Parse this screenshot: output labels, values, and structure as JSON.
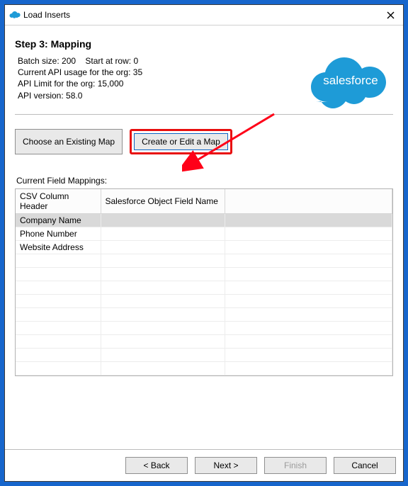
{
  "titlebar": {
    "title": "Load Inserts"
  },
  "step": {
    "heading": "Step 3: Mapping"
  },
  "info": {
    "batch_size_label": "Batch size:",
    "batch_size_value": "200",
    "start_row_label": "Start at row:",
    "start_row_value": "0",
    "api_usage_label": "Current API usage for the org:",
    "api_usage_value": "35",
    "api_limit_label": "API Limit for the org:",
    "api_limit_value": "15,000",
    "api_version_label": "API version:",
    "api_version_value": "58.0"
  },
  "buttons": {
    "choose_map": "Choose an Existing Map",
    "create_map": "Create or Edit a Map"
  },
  "mappings": {
    "label": "Current Field Mappings:",
    "columns": {
      "csv": "CSV Column Header",
      "sfield": "Salesforce Object Field Name"
    },
    "rows": [
      {
        "csv": "Company Name",
        "sfield": ""
      },
      {
        "csv": "Phone Number",
        "sfield": ""
      },
      {
        "csv": "Website Address",
        "sfield": ""
      }
    ]
  },
  "footer": {
    "back": "< Back",
    "next": "Next >",
    "finish": "Finish",
    "cancel": "Cancel"
  },
  "logo": {
    "text": "salesforce"
  },
  "colors": {
    "accent": "#1E9BD7",
    "highlight": "#e80f0f",
    "arrow": "#ff0018"
  }
}
